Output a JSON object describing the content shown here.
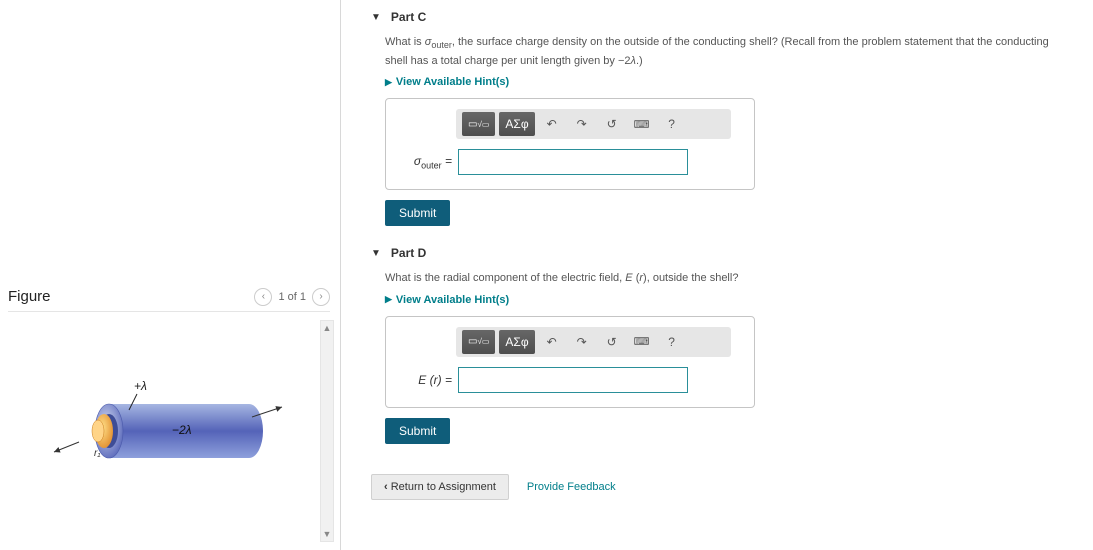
{
  "figure": {
    "title": "Figure",
    "pager_label": "1 of 1",
    "label_top": "+λ",
    "label_mid": "−2λ",
    "label_inner": "r₁"
  },
  "parts": [
    {
      "id": "C",
      "title": "Part C",
      "prompt_html": "What is σ_outer, the surface charge density on the outside of the conducting shell? (Recall from the problem statement that the conducting shell has a total charge per unit length given by −2λ.)",
      "hints_label": "View Available Hint(s)",
      "var_label_html": "σ_outer =",
      "submit_label": "Submit"
    },
    {
      "id": "D",
      "title": "Part D",
      "prompt_html": "What is the radial component of the electric field, E(r), outside the shell?",
      "hints_label": "View Available Hint(s)",
      "var_label_html": "E(r) =",
      "submit_label": "Submit"
    }
  ],
  "toolbar": {
    "template_btn": "▭ √▭",
    "greek_btn": "ΑΣφ",
    "undo": "↶",
    "redo": "↷",
    "reset": "↺",
    "keyboard": "⌨",
    "help": "?"
  },
  "footer": {
    "return_label": "Return to Assignment",
    "feedback_label": "Provide Feedback"
  }
}
